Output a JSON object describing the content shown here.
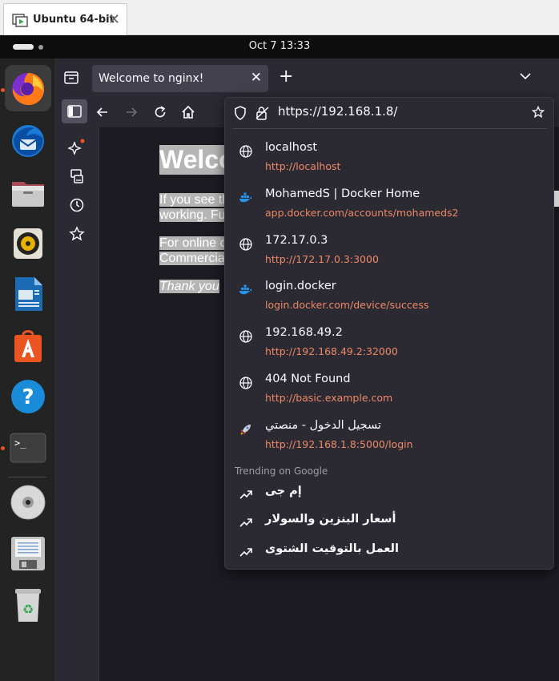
{
  "vm": {
    "tab_title": "Ubuntu 64-bit",
    "close_glyph": "✕"
  },
  "topbar": {
    "clock": "Oct 7  13:33"
  },
  "dock": {
    "items": [
      {
        "name": "Firefox",
        "icon": "firefox-icon",
        "running": true,
        "active": true
      },
      {
        "name": "Thunderbird",
        "icon": "thunderbird-icon",
        "running": false
      },
      {
        "name": "Files",
        "icon": "files-icon",
        "running": false
      },
      {
        "name": "Rhythmbox",
        "icon": "rhythmbox-icon",
        "running": false
      },
      {
        "name": "LibreOffice Writer",
        "icon": "writer-icon",
        "running": false
      },
      {
        "name": "App Center",
        "icon": "app-center-icon",
        "running": false
      },
      {
        "name": "Help",
        "icon": "help-icon",
        "running": false
      },
      {
        "name": "Terminal",
        "icon": "terminal-icon",
        "running": true
      },
      {
        "name": "Disc",
        "icon": "disc-icon",
        "running": false
      },
      {
        "name": "Save",
        "icon": "floppy-icon",
        "running": false
      },
      {
        "name": "Trash",
        "icon": "trash-icon",
        "running": false
      }
    ]
  },
  "browser": {
    "tab_title": "Welcome to nginx!",
    "new_tab_glyph": "+",
    "url": "https://192.168.1.8/",
    "accent": "#ee8866",
    "suggestions": [
      {
        "title": "localhost",
        "url": "http://localhost",
        "icon": "globe-icon"
      },
      {
        "title": "MohamedS | Docker Home",
        "url": "app.docker.com/accounts/mohameds2",
        "icon": "docker-icon"
      },
      {
        "title": "172.17.0.3",
        "url": "http://172.17.0.3:3000",
        "icon": "globe-icon"
      },
      {
        "title": "login.docker",
        "url": "login.docker.com/device/success",
        "icon": "docker-icon"
      },
      {
        "title": "192.168.49.2",
        "url": "http://192.168.49.2:32000",
        "icon": "globe-icon"
      },
      {
        "title": "404 Not Found",
        "url": "http://basic.example.com",
        "icon": "globe-icon"
      },
      {
        "title": "تسجيل الدخول - منصتي",
        "url": "http://192.168.1.8:5000/login",
        "icon": "rocket-icon"
      }
    ],
    "trending_heading": "Trending on Google",
    "trending": [
      {
        "text": "إم جى"
      },
      {
        "text": "أسعار البنزين والسولار"
      },
      {
        "text": "العمل بالتوقيت الشتوى"
      }
    ]
  },
  "page": {
    "heading": "Welco",
    "p1_line1": "If you see th",
    "p1_line2": "working. Fu",
    "p2_line1": "For online d",
    "p2_line2": "Commercia",
    "p3": "Thank you"
  }
}
